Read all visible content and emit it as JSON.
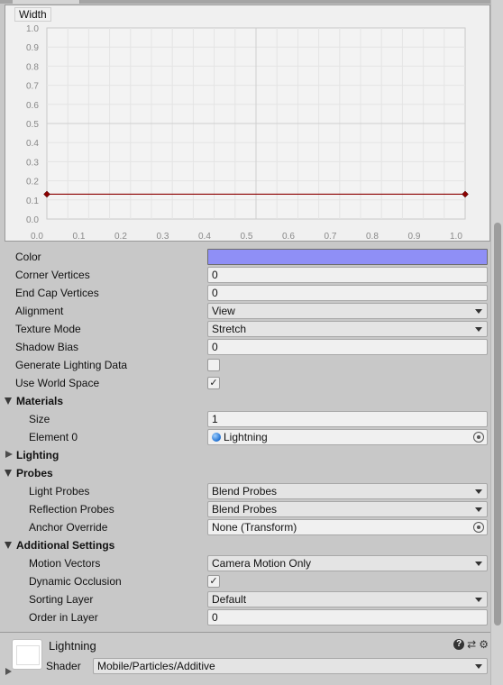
{
  "curve": {
    "title": "Width",
    "y_ticks": [
      "1.0",
      "0.9",
      "0.8",
      "0.7",
      "0.6",
      "0.5",
      "0.4",
      "0.3",
      "0.2",
      "0.1",
      "0.0"
    ],
    "x_ticks": [
      "0.0",
      "0.1",
      "0.2",
      "0.3",
      "0.4",
      "0.5",
      "0.6",
      "0.7",
      "0.8",
      "0.9",
      "1.0"
    ],
    "keys": [
      {
        "time": 0.0,
        "value": 0.13
      },
      {
        "time": 1.0,
        "value": 0.13
      }
    ],
    "curve_color": "#8b0000"
  },
  "properties": {
    "color": {
      "label": "Color",
      "value_hex": "#8f8ff6"
    },
    "corner_vertices": {
      "label": "Corner Vertices",
      "value": "0"
    },
    "end_cap_vertices": {
      "label": "End Cap Vertices",
      "value": "0"
    },
    "alignment": {
      "label": "Alignment",
      "value": "View"
    },
    "texture_mode": {
      "label": "Texture Mode",
      "value": "Stretch"
    },
    "shadow_bias": {
      "label": "Shadow Bias",
      "value": "0"
    },
    "generate_lighting_data": {
      "label": "Generate Lighting Data",
      "checked": false,
      "check_glyph": ""
    },
    "use_world_space": {
      "label": "Use World Space",
      "checked": true,
      "check_glyph": "✓"
    }
  },
  "materials": {
    "header": "Materials",
    "size": {
      "label": "Size",
      "value": "1"
    },
    "element0": {
      "label": "Element 0",
      "value": "Lightning"
    }
  },
  "lighting": {
    "header": "Lighting"
  },
  "probes": {
    "header": "Probes",
    "light_probes": {
      "label": "Light Probes",
      "value": "Blend Probes"
    },
    "reflection_probes": {
      "label": "Reflection Probes",
      "value": "Blend Probes"
    },
    "anchor_override": {
      "label": "Anchor Override",
      "value": "None (Transform)"
    }
  },
  "additional": {
    "header": "Additional Settings",
    "motion_vectors": {
      "label": "Motion Vectors",
      "value": "Camera Motion Only"
    },
    "dynamic_occlusion": {
      "label": "Dynamic Occlusion",
      "checked": true,
      "check_glyph": "✓"
    },
    "sorting_layer": {
      "label": "Sorting Layer",
      "value": "Default"
    },
    "order_in_layer": {
      "label": "Order in Layer",
      "value": "0"
    }
  },
  "material_footer": {
    "name": "Lightning",
    "shader_label": "Shader",
    "shader_value": "Mobile/Particles/Additive",
    "help_glyph": "?",
    "settings_glyph": "⚙",
    "presets_glyph": "⇄"
  }
}
